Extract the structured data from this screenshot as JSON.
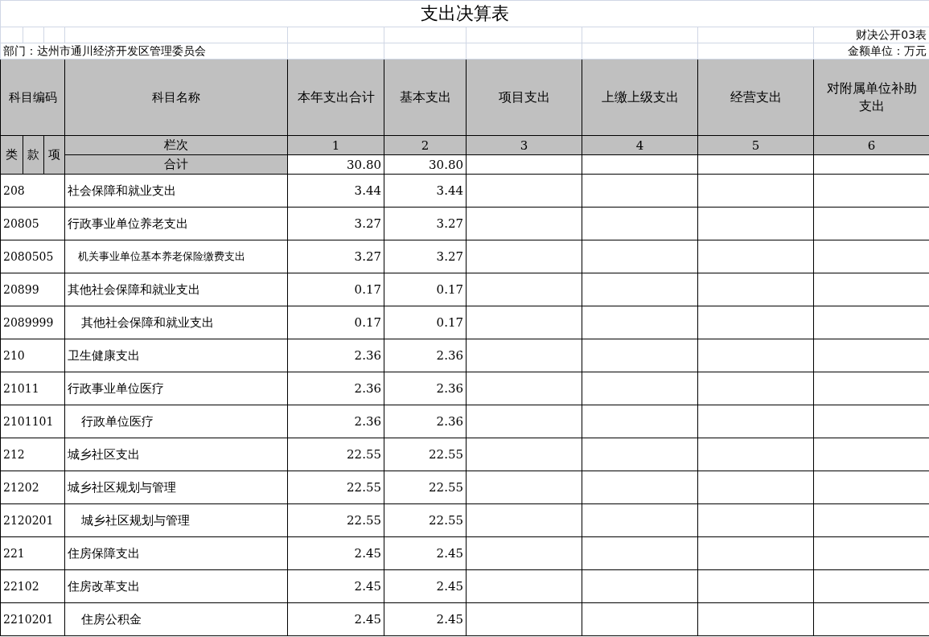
{
  "title": "支出决算表",
  "form_no": "财决公开03表",
  "department": "部门：达州市通川经济开发区管理委员会",
  "unit": "金额单位：万元",
  "header": {
    "code": "科目编码",
    "name": "科目名称",
    "columns": [
      "本年支出合计",
      "基本支出",
      "项目支出",
      "上缴上级支出",
      "经营支出",
      "对附属单位补助支出"
    ],
    "code_parts": [
      "类",
      "款",
      "项"
    ],
    "index_label": "栏次",
    "indices": [
      "1",
      "2",
      "3",
      "4",
      "5",
      "6"
    ],
    "total_label": "合计",
    "totals": [
      "30.80",
      "30.80"
    ]
  },
  "rows": [
    {
      "code": "208",
      "name": "社会保障和就业支出",
      "kind": "category",
      "values": [
        "3.44",
        "3.44"
      ]
    },
    {
      "code": "20805",
      "name": "行政事业单位养老支出",
      "kind": "section",
      "values": [
        "3.27",
        "3.27"
      ]
    },
    {
      "code": "2080505",
      "name": "机关事业单位基本养老保险缴费支出",
      "kind": "item",
      "values": [
        "3.27",
        "3.27"
      ]
    },
    {
      "code": "20899",
      "name": "其他社会保障和就业支出",
      "kind": "section",
      "values": [
        "0.17",
        "0.17"
      ]
    },
    {
      "code": "2089999",
      "name": "其他社会保障和就业支出",
      "kind": "item",
      "values": [
        "0.17",
        "0.17"
      ]
    },
    {
      "code": "210",
      "name": "卫生健康支出",
      "kind": "category",
      "values": [
        "2.36",
        "2.36"
      ]
    },
    {
      "code": "21011",
      "name": "行政事业单位医疗",
      "kind": "section",
      "values": [
        "2.36",
        "2.36"
      ]
    },
    {
      "code": "2101101",
      "name": "行政单位医疗",
      "kind": "item",
      "values": [
        "2.36",
        "2.36"
      ]
    },
    {
      "code": "212",
      "name": "城乡社区支出",
      "kind": "category",
      "values": [
        "22.55",
        "22.55"
      ]
    },
    {
      "code": "21202",
      "name": "城乡社区规划与管理",
      "kind": "section",
      "values": [
        "22.55",
        "22.55"
      ]
    },
    {
      "code": "2120201",
      "name": "城乡社区规划与管理",
      "kind": "item",
      "values": [
        "22.55",
        "22.55"
      ]
    },
    {
      "code": "221",
      "name": "住房保障支出",
      "kind": "category",
      "values": [
        "2.45",
        "2.45"
      ]
    },
    {
      "code": "22102",
      "name": "住房改革支出",
      "kind": "section",
      "values": [
        "2.45",
        "2.45"
      ]
    },
    {
      "code": "2210201",
      "name": "住房公积金",
      "kind": "item",
      "values": [
        "2.45",
        "2.45"
      ]
    }
  ]
}
